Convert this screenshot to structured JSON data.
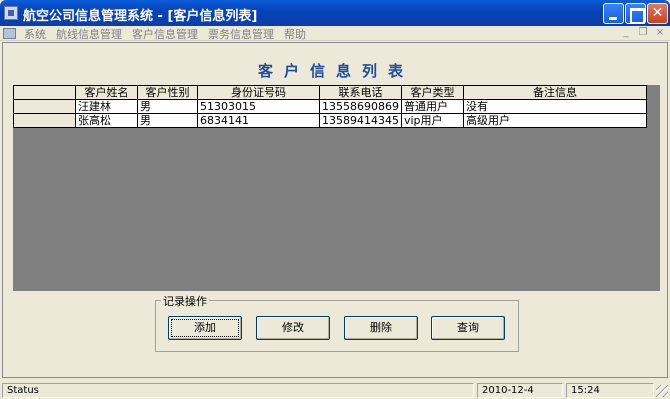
{
  "window": {
    "title": "航空公司信息管理系统 - [客户信息列表]",
    "close_glyph": "✕"
  },
  "menu": {
    "items": [
      "系统",
      "航线信息管理",
      "客户信息管理",
      "票务信息管理",
      "帮助"
    ],
    "mdi_controls": [
      "_",
      "❐",
      "×"
    ]
  },
  "form": {
    "heading": "客户信息列表"
  },
  "grid": {
    "columns": [
      "客户姓名",
      "客户性别",
      "身份证号码",
      "联系电话",
      "客户类型",
      "备注信息"
    ],
    "rows": [
      [
        "汪建林",
        "男",
        "51303015",
        "13558690869",
        "普通用户",
        "没有"
      ],
      [
        "张高松",
        "男",
        "6834141",
        "13589414345",
        "vip用户",
        "高级用户"
      ]
    ]
  },
  "records": {
    "group_label": "记录操作",
    "add_label": "添加",
    "edit_label": "修改",
    "delete_label": "删除",
    "query_label": "查询"
  },
  "status": {
    "text": "Status",
    "date": "2010-12-4",
    "time": "15:24"
  },
  "colors": {
    "titlebar": "#0842b8",
    "heading": "#1f4e9c",
    "grid_background": "#808080",
    "face": "#ece9d8"
  }
}
